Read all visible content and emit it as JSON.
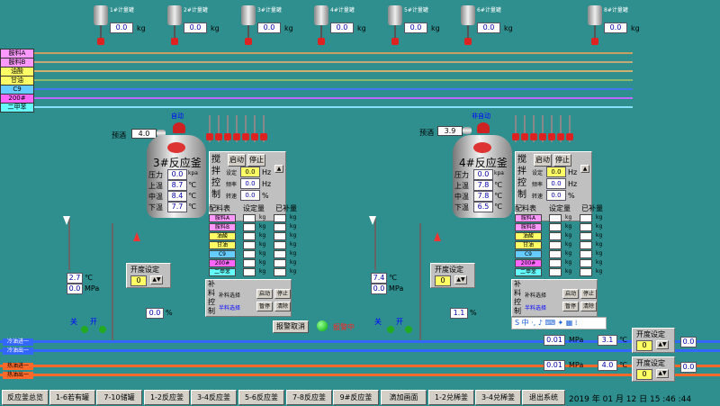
{
  "meters": [
    {
      "name": "1#计量罐",
      "value": "0.0",
      "unit": "kg"
    },
    {
      "name": "2#计量罐",
      "value": "0.0",
      "unit": "kg"
    },
    {
      "name": "3#计量罐",
      "value": "0.0",
      "unit": "kg"
    },
    {
      "name": "4#计量罐",
      "value": "0.0",
      "unit": "kg"
    },
    {
      "name": "5#计量罐",
      "value": "0.0",
      "unit": "kg"
    },
    {
      "name": "6#计量罐",
      "value": "0.0",
      "unit": "kg"
    },
    {
      "name": "8#计量罐",
      "value": "0.0",
      "unit": "kg"
    }
  ],
  "materials": [
    "胺料A",
    "胺料B",
    "油酸",
    "甘油",
    "C9",
    "200#",
    "二甲苯"
  ],
  "colors": {
    "胺料A": "#ff99ff",
    "胺料B": "#ff99ff",
    "油酸": "#ffff66",
    "甘油": "#ffff66",
    "C9": "#66ccff",
    "200#": "#ff66ff",
    "二甲苯": "#66ffff"
  },
  "reactor3": {
    "title": "3#反应釜",
    "mode": "自动",
    "seal_label": "预酒",
    "seal_value": "4.0",
    "pressure_label": "压力",
    "pressure": "0.0",
    "pressure_unit": "kpa",
    "top_label": "上温",
    "top_temp": "8.7",
    "mid_label": "中温",
    "mid_temp": "8.4",
    "bot_label": "下温",
    "bot_temp": "7.7",
    "temp_unit": "℃",
    "stir_title": "搅拌控制",
    "start": "启动",
    "stop": "停止",
    "set_label": "设定",
    "set_value": "0.0",
    "hz": "Hz",
    "freq_label": "频率",
    "freq_value": "0.0",
    "speed_label": "转速",
    "speed_value": "0.0",
    "pct": "%",
    "recipe_title": "配料表",
    "set_amount": "设定量",
    "added": "已补量",
    "kg": "kg",
    "supplement_title": "补料控制",
    "supp_select": "补料选择",
    "semi_select": "半料选择",
    "supp_start": "启动",
    "supp_stop": "停止",
    "supp_pause": "暂停",
    "supp_clear": "清除",
    "opening_title": "开度设定",
    "opening_value": "0",
    "bottom_temp": "2.7",
    "bottom_pressure": "0.0",
    "mpa": "MPa",
    "valve_pct": "0.0",
    "close": "关",
    "open": "开"
  },
  "reactor4": {
    "title": "4#反应釜",
    "mode": "非自动",
    "seal_label": "预酒",
    "seal_value": "3.9",
    "pressure_label": "压力",
    "pressure": "0.0",
    "pressure_unit": "kpa",
    "top_label": "上温",
    "top_temp": "7.8",
    "mid_label": "中温",
    "mid_temp": "7.8",
    "bot_label": "下温",
    "bot_temp": "6.5",
    "temp_unit": "℃",
    "stir_title": "搅拌控制",
    "start": "启动",
    "stop": "停止",
    "set_label": "设定",
    "set_value": "0.0",
    "hz": "Hz",
    "freq_label": "频率",
    "freq_value": "0.0",
    "speed_label": "转速",
    "speed_value": "0.0",
    "pct": "%",
    "recipe_title": "配料表",
    "set_amount": "设定量",
    "added": "已补量",
    "kg": "kg",
    "supplement_title": "补料控制",
    "supp_select": "补料选择",
    "semi_select": "半料选择",
    "supp_start": "启动",
    "supp_stop": "停止",
    "supp_pause": "暂停",
    "supp_clear": "清除",
    "opening_title": "开度设定",
    "opening_value": "0",
    "bottom_temp": "7.4",
    "bottom_pressure": "0.0",
    "mpa": "MPa",
    "valve_pct": "1.1",
    "close": "关",
    "open": "开"
  },
  "alarm": {
    "cancel": "报警取消",
    "status": "报警中"
  },
  "cooling": {
    "in": "冷油进一",
    "out": "冷油出一",
    "pressure": "0.01",
    "mpa": "MPa",
    "temp": "3.1",
    "unit": "℃",
    "opening_title": "开度设定",
    "opening_value": "0",
    "pct_value": "0.0"
  },
  "heating": {
    "in": "热油进一",
    "out": "热油出一",
    "pressure": "0.01",
    "mpa": "MPa",
    "temp": "4.0",
    "unit": "℃",
    "opening_title": "开度设定",
    "opening_value": "0",
    "pct_value": "0.0"
  },
  "nav": [
    "反应釜总览",
    "1-6若有罐",
    "7-10储罐",
    "1-2反应釜",
    "3-4反应釜",
    "5-6反应釜",
    "7-8反应釜",
    "9#反应釜",
    "滴加画面",
    "1-2兑稀釜",
    "3-4兑稀釜",
    "退出系统"
  ],
  "datetime": "2019 年 01 月 12 日  15 :46 :44"
}
